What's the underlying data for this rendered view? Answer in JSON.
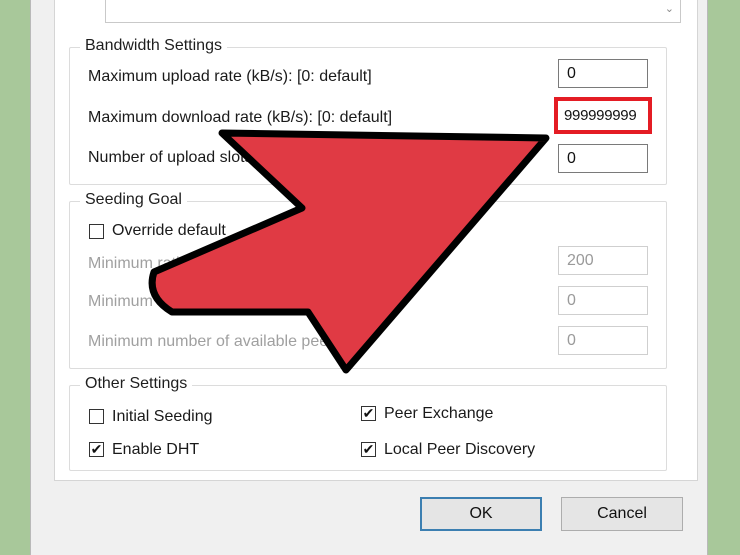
{
  "colors": {
    "background": "#a8c89a",
    "highlight_box": "#e41c24",
    "arrow_fill": "#e03a44",
    "arrow_outline": "#000000"
  },
  "top_dropdown": {
    "icon": "chevron-down-icon",
    "glyph": "⌄"
  },
  "bandwidth": {
    "title": "Bandwidth Settings",
    "upload_label": "Maximum upload rate (kB/s): [0: default]",
    "upload_value": "0",
    "download_label": "Maximum download rate (kB/s): [0: default]",
    "download_value": "999999999",
    "slots_label": "Number of upload slots:",
    "slots_value": "0"
  },
  "seeding": {
    "title": "Seeding Goal",
    "override_label": "Override default",
    "override_checked": false,
    "min_ratio_label": "Minimum ratio",
    "min_ratio_value": "200",
    "min_time_label": "Minimum seeding time (minutes):",
    "min_time_value": "0",
    "min_avail_label": "Minimum number of available peers:",
    "min_avail_value": "0"
  },
  "other": {
    "title": "Other Settings",
    "initial_seeding_label": "Initial Seeding",
    "initial_seeding_checked": false,
    "enable_dht_label": "Enable DHT",
    "enable_dht_checked": true,
    "peer_exchange_label": "Peer Exchange",
    "peer_exchange_checked": true,
    "local_peer_label": "Local Peer Discovery",
    "local_peer_checked": true,
    "check_glyph": "✔"
  },
  "buttons": {
    "ok": "OK",
    "cancel": "Cancel"
  }
}
